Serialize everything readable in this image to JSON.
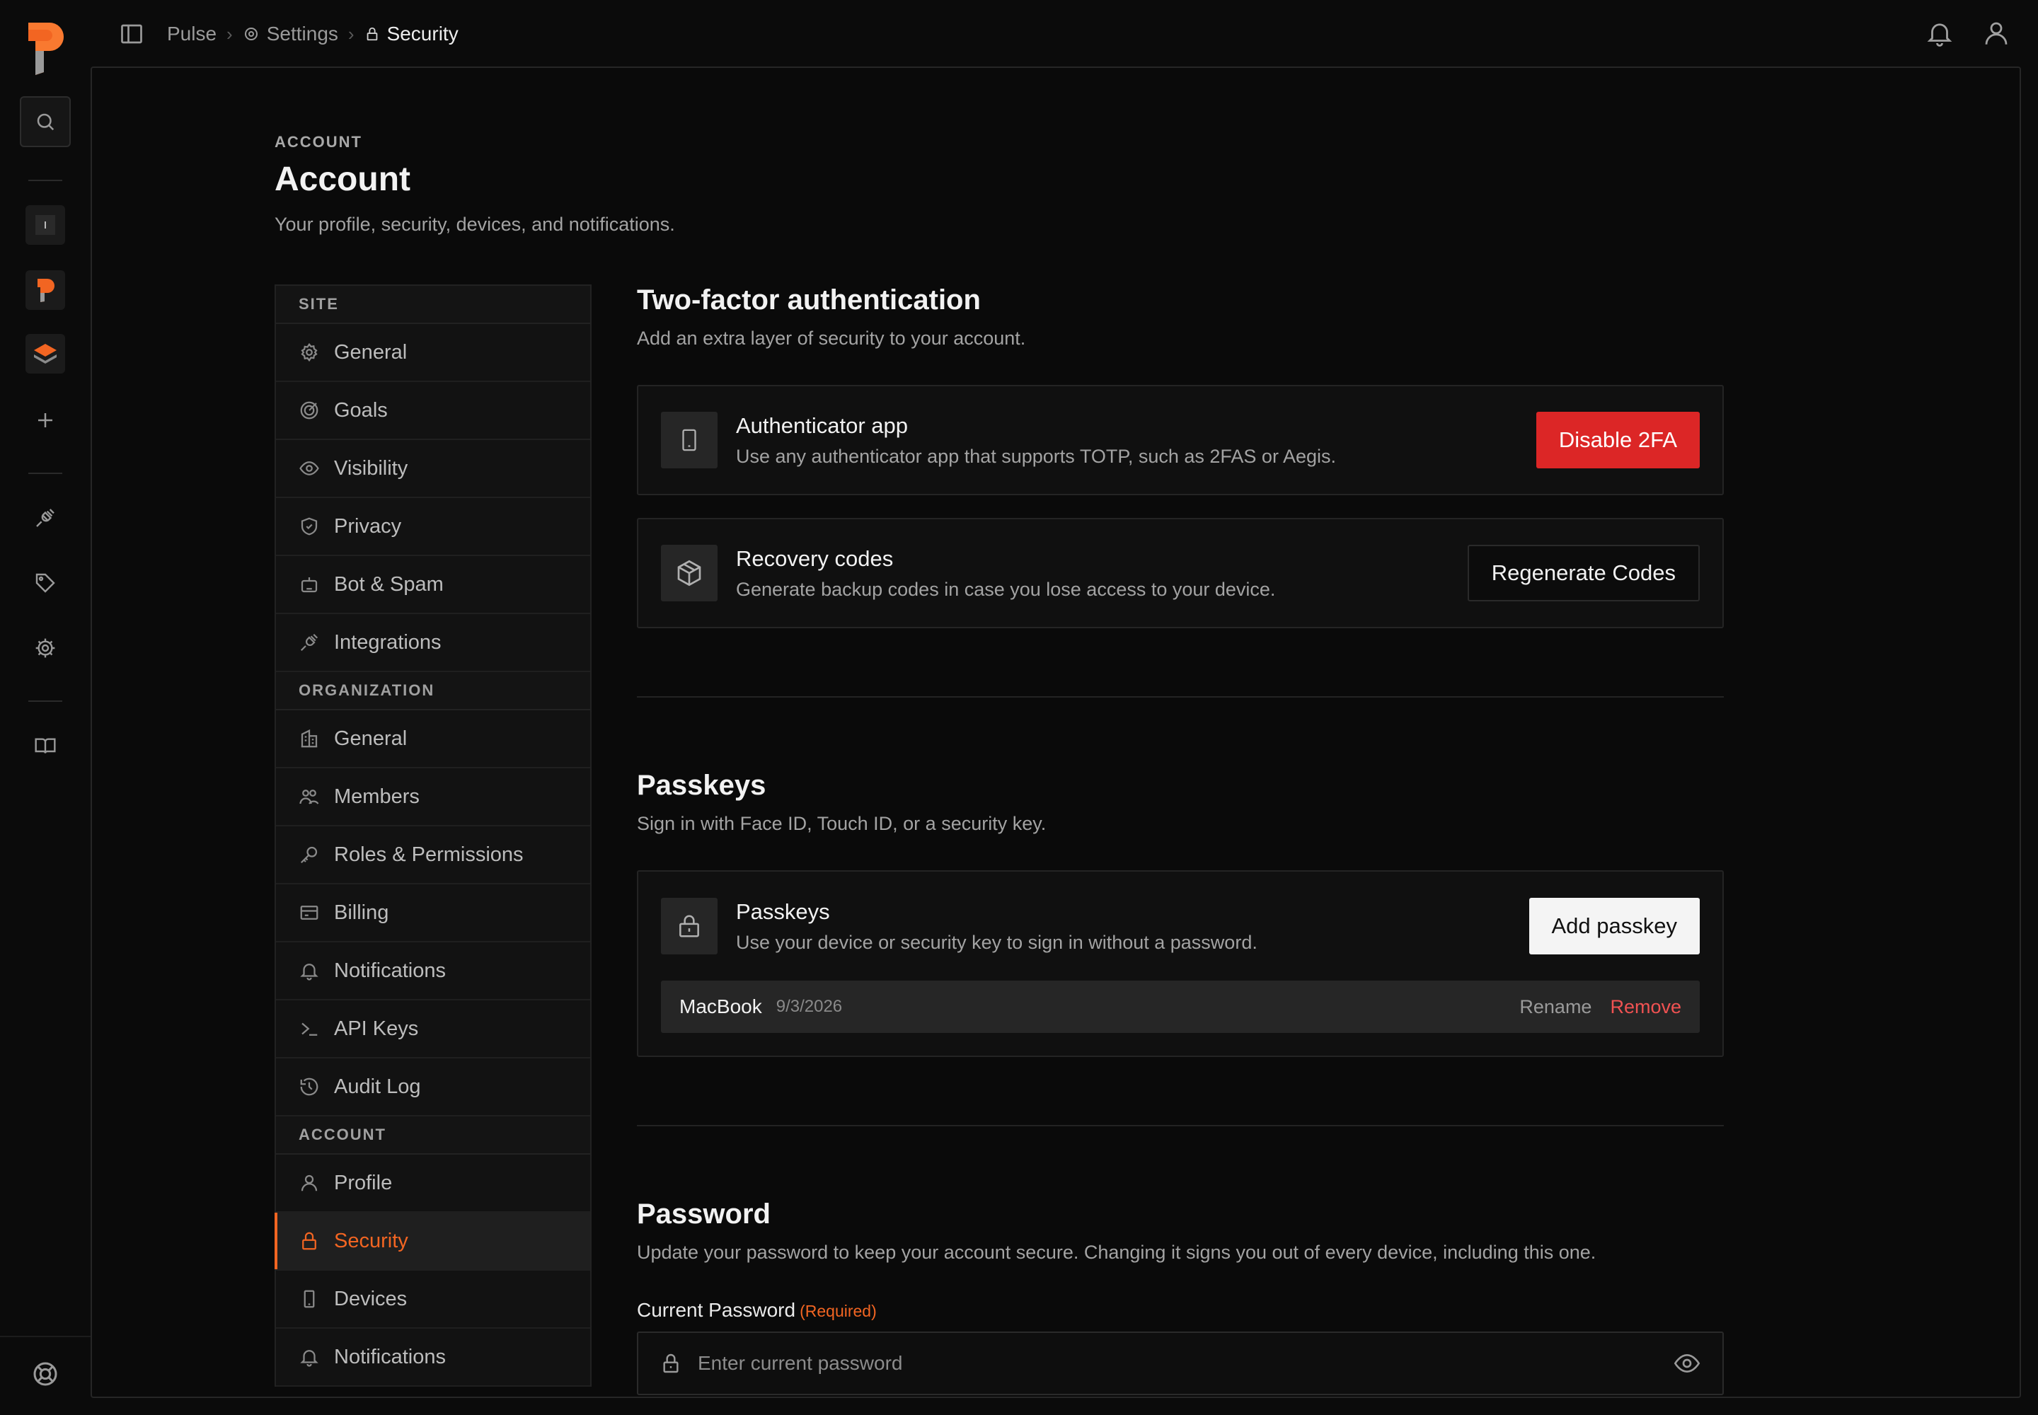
{
  "colors": {
    "accent": "#f26522",
    "danger": "#dc2626",
    "remove": "#f05252",
    "background": "#0b0b0b"
  },
  "topbar": {
    "breadcrumbs": [
      {
        "label": "Pulse",
        "icon": ""
      },
      {
        "label": "Settings",
        "icon": "gear-icon"
      },
      {
        "label": "Security",
        "icon": "lock-icon"
      }
    ]
  },
  "header": {
    "eyebrow": "ACCOUNT",
    "title": "Account",
    "subtitle": "Your profile, security, devices, and notifications."
  },
  "nav": {
    "groups": [
      {
        "label": "SITE",
        "items": [
          {
            "label": "General",
            "icon": "gear-icon"
          },
          {
            "label": "Goals",
            "icon": "target-icon"
          },
          {
            "label": "Visibility",
            "icon": "eye-icon"
          },
          {
            "label": "Privacy",
            "icon": "shield-icon"
          },
          {
            "label": "Bot & Spam",
            "icon": "bot-icon"
          },
          {
            "label": "Integrations",
            "icon": "plug-icon"
          }
        ]
      },
      {
        "label": "ORGANIZATION",
        "items": [
          {
            "label": "General",
            "icon": "building-icon"
          },
          {
            "label": "Members",
            "icon": "users-icon"
          },
          {
            "label": "Roles & Permissions",
            "icon": "key-icon"
          },
          {
            "label": "Billing",
            "icon": "credit-card-icon"
          },
          {
            "label": "Notifications",
            "icon": "bell-icon"
          },
          {
            "label": "API Keys",
            "icon": "terminal-icon"
          },
          {
            "label": "Audit Log",
            "icon": "history-icon"
          }
        ]
      },
      {
        "label": "ACCOUNT",
        "items": [
          {
            "label": "Profile",
            "icon": "user-icon"
          },
          {
            "label": "Security",
            "icon": "lock-icon",
            "active": true
          },
          {
            "label": "Devices",
            "icon": "phone-icon"
          },
          {
            "label": "Notifications",
            "icon": "bell-icon"
          }
        ]
      }
    ]
  },
  "two_factor": {
    "title": "Two-factor authentication",
    "description": "Add an extra layer of security to your account.",
    "authenticator": {
      "title": "Authenticator app",
      "description": "Use any authenticator app that supports TOTP, such as 2FAS or Aegis.",
      "button": "Disable 2FA"
    },
    "recovery": {
      "title": "Recovery codes",
      "description": "Generate backup codes in case you lose access to your device.",
      "button": "Regenerate Codes"
    }
  },
  "passkeys": {
    "title": "Passkeys",
    "description": "Sign in with Face ID, Touch ID, or a security key.",
    "card": {
      "title": "Passkeys",
      "description": "Use your device or security key to sign in without a password.",
      "button": "Add passkey"
    },
    "items": [
      {
        "name": "MacBook",
        "date": "9/3/2026",
        "rename": "Rename",
        "remove": "Remove"
      }
    ]
  },
  "password": {
    "title": "Password",
    "description": "Update your password to keep your account secure. Changing it signs you out of every device, including this one.",
    "current_label": "Current Password",
    "required_tag": "(Required)",
    "current_placeholder": "Enter current password"
  }
}
